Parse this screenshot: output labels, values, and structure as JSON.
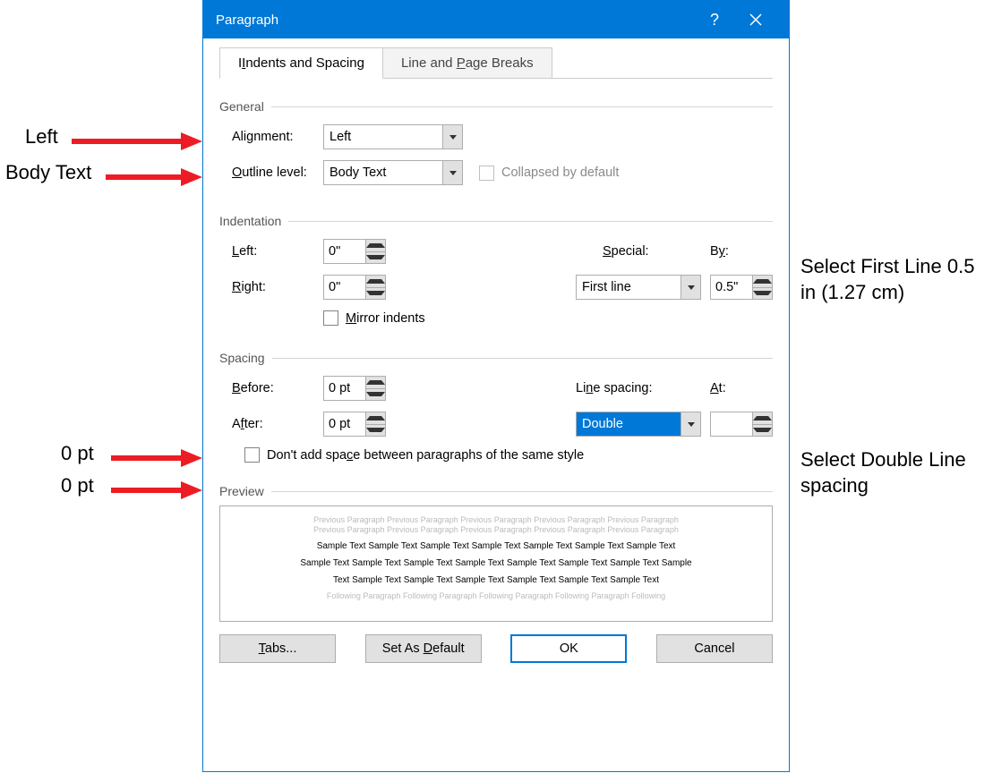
{
  "titlebar": {
    "title": "Paragraph"
  },
  "tabs": {
    "indents": "Indents and Spacing",
    "breaks": "Line and Page Breaks"
  },
  "general": {
    "heading": "General",
    "alignment_label": "Alignment:",
    "alignment_value": "Left",
    "outline_label": "Outline level:",
    "outline_value": "Body Text",
    "collapsed": "Collapsed by default"
  },
  "indentation": {
    "heading": "Indentation",
    "left_label": "Left:",
    "left_value": "0\"",
    "right_label": "Right:",
    "right_value": "0\"",
    "special_label": "Special:",
    "special_value": "First line",
    "by_label": "By:",
    "by_value": "0.5\"",
    "mirror": "Mirror indents"
  },
  "spacing": {
    "heading": "Spacing",
    "before_label": "Before:",
    "before_value": "0 pt",
    "after_label": "After:",
    "after_value": "0 pt",
    "line_label": "Line spacing:",
    "line_value": "Double",
    "at_label": "At:",
    "at_value": "",
    "dont_add": "Don't add space between paragraphs of the same style"
  },
  "preview": {
    "heading": "Preview",
    "prev1": "Previous Paragraph Previous Paragraph Previous Paragraph Previous Paragraph Previous Paragraph",
    "prev2": "Previous Paragraph Previous Paragraph Previous Paragraph Previous Paragraph Previous Paragraph",
    "samp1": "Sample Text Sample Text Sample Text Sample Text Sample Text Sample Text Sample Text",
    "samp2": "Sample Text Sample Text Sample Text Sample Text Sample Text Sample Text Sample Text Sample",
    "samp3": "Text Sample Text Sample Text Sample Text Sample Text Sample Text Sample Text",
    "foll": "Following Paragraph Following Paragraph Following Paragraph Following Paragraph Following"
  },
  "buttons": {
    "tabs": "Tabs...",
    "default": "Set As Default",
    "ok": "OK",
    "cancel": "Cancel"
  },
  "callouts": {
    "left": "Left",
    "bodytext": "Body Text",
    "zpt1": "0 pt",
    "zpt2": "0 pt",
    "firstline": "Select First Line 0.5 in (1.27 cm)",
    "double": "Select Double Line spacing"
  }
}
